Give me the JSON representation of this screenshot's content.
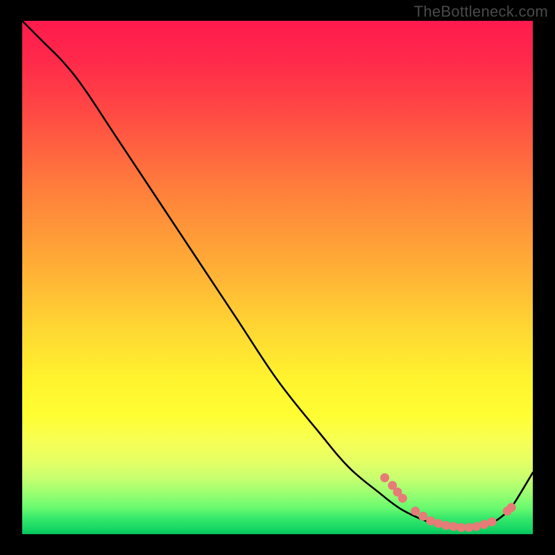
{
  "watermark": "TheBottleneck.com",
  "chart_data": {
    "type": "line",
    "title": "",
    "xlabel": "",
    "ylabel": "",
    "xlim": [
      0,
      100
    ],
    "ylim": [
      0,
      100
    ],
    "grid": false,
    "legend": false,
    "series": [
      {
        "name": "bottleneck-curve",
        "x": [
          0,
          4,
          8,
          12,
          18,
          26,
          34,
          42,
          50,
          58,
          64,
          70,
          74,
          78,
          81,
          84,
          87,
          90,
          92,
          94,
          96,
          100
        ],
        "y": [
          100,
          96,
          92,
          87,
          78,
          66,
          54,
          42,
          30,
          20,
          13,
          8,
          5,
          3,
          2,
          1.5,
          1.2,
          1.5,
          2.2,
          3.5,
          5.5,
          12
        ]
      }
    ],
    "markers": {
      "series": "bottleneck-curve",
      "points": [
        {
          "x": 71,
          "y": 11
        },
        {
          "x": 72.5,
          "y": 9.5
        },
        {
          "x": 73.5,
          "y": 8.2
        },
        {
          "x": 74.5,
          "y": 7.0
        },
        {
          "x": 77,
          "y": 4.5
        },
        {
          "x": 78.5,
          "y": 3.5
        },
        {
          "x": 80,
          "y": 2.6
        },
        {
          "x": 81.5,
          "y": 2.1
        },
        {
          "x": 83,
          "y": 1.7
        },
        {
          "x": 84.5,
          "y": 1.5
        },
        {
          "x": 86,
          "y": 1.3
        },
        {
          "x": 87.5,
          "y": 1.3
        },
        {
          "x": 89,
          "y": 1.5
        },
        {
          "x": 90.5,
          "y": 1.9
        },
        {
          "x": 92,
          "y": 2.4
        },
        {
          "x": 95,
          "y": 4.5
        },
        {
          "x": 95.8,
          "y": 5.2
        }
      ],
      "radius": 6.5
    },
    "background_gradient": {
      "top": "#ff1a4d",
      "mid": "#fff42e",
      "bottom": "#06c25c"
    }
  }
}
